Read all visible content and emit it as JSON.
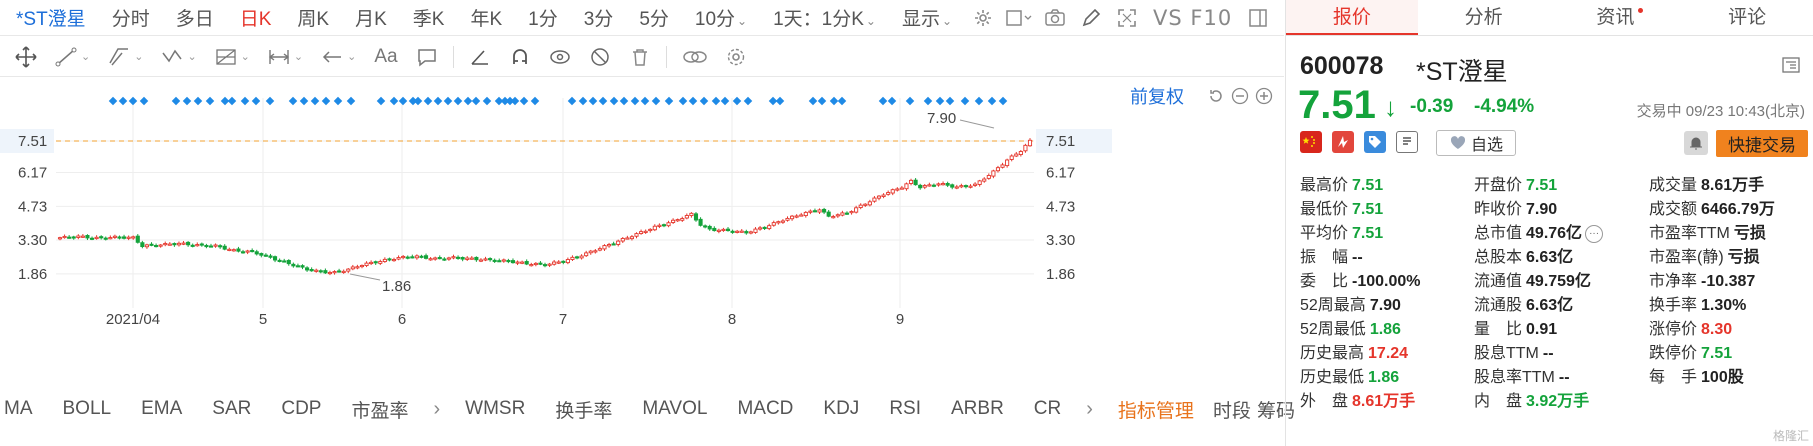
{
  "period_bar": {
    "stock_tab": "*ST澄星",
    "items": [
      "分时",
      "多日",
      "日K",
      "周K",
      "月K",
      "季K",
      "年K",
      "1分",
      "3分",
      "5分",
      "10分"
    ],
    "active": "日K",
    "range_select": "1天：1分K",
    "display": "显示",
    "vs": "VS F10"
  },
  "draw_bar": {
    "aa": "Aa"
  },
  "chart": {
    "fuquan": "前复权",
    "y_ticks": [
      "7.51",
      "6.17",
      "4.73",
      "3.30",
      "1.86"
    ],
    "x_ticks": [
      "2021/04",
      "5",
      "6",
      "7",
      "8",
      "9"
    ],
    "high_label": "7.90",
    "low_label": "1.86",
    "colors": {
      "up": "#e5352b",
      "down": "#14a33b",
      "dash": "#f0a030",
      "event": "#1e8ae6"
    }
  },
  "chart_data": {
    "type": "candlestick",
    "y_ticks": [
      7.51,
      6.17,
      4.73,
      3.3,
      1.86
    ],
    "x_ticks": [
      "2021/04",
      "5",
      "6",
      "7",
      "8",
      "9"
    ],
    "high": 7.9,
    "low": 1.86,
    "last": 7.51,
    "close_path": [
      [
        0,
        3.4
      ],
      [
        4,
        3.45
      ],
      [
        8,
        3.38
      ],
      [
        12,
        3.42
      ],
      [
        16,
        3.4
      ],
      [
        18,
        3.05
      ],
      [
        22,
        3.1
      ],
      [
        26,
        3.15
      ],
      [
        30,
        3.08
      ],
      [
        34,
        3.05
      ],
      [
        38,
        2.85
      ],
      [
        42,
        2.8
      ],
      [
        46,
        2.55
      ],
      [
        50,
        2.3
      ],
      [
        54,
        2.05
      ],
      [
        57,
        1.95
      ],
      [
        60,
        1.92
      ],
      [
        63,
        2.05
      ],
      [
        66,
        2.25
      ],
      [
        70,
        2.4
      ],
      [
        74,
        2.55
      ],
      [
        78,
        2.6
      ],
      [
        82,
        2.5
      ],
      [
        86,
        2.55
      ],
      [
        90,
        2.5
      ],
      [
        94,
        2.45
      ],
      [
        98,
        2.4
      ],
      [
        102,
        2.3
      ],
      [
        106,
        2.25
      ],
      [
        110,
        2.4
      ],
      [
        114,
        2.65
      ],
      [
        118,
        2.95
      ],
      [
        122,
        3.25
      ],
      [
        126,
        3.55
      ],
      [
        130,
        3.85
      ],
      [
        134,
        4.1
      ],
      [
        138,
        4.4
      ],
      [
        140,
        3.95
      ],
      [
        142,
        3.75
      ],
      [
        146,
        3.7
      ],
      [
        150,
        3.62
      ],
      [
        154,
        3.85
      ],
      [
        158,
        4.15
      ],
      [
        162,
        4.4
      ],
      [
        166,
        4.6
      ],
      [
        168,
        4.3
      ],
      [
        172,
        4.45
      ],
      [
        176,
        4.85
      ],
      [
        180,
        5.25
      ],
      [
        184,
        5.55
      ],
      [
        186,
        5.8
      ],
      [
        188,
        5.55
      ],
      [
        192,
        5.7
      ],
      [
        196,
        5.55
      ],
      [
        200,
        5.65
      ],
      [
        204,
        6.2
      ],
      [
        207,
        6.7
      ],
      [
        210,
        7.1
      ],
      [
        212,
        7.51
      ]
    ]
  },
  "indicators": {
    "items": [
      "MA",
      "BOLL",
      "EMA",
      "SAR",
      "CDP",
      "市盈率",
      "WMSR",
      "换手率",
      "MAVOL",
      "MACD",
      "KDJ",
      "RSI",
      "ARBR",
      "CR"
    ],
    "manage": "指标管理",
    "right": [
      "时段",
      "筹码"
    ]
  },
  "quote": {
    "tabs": [
      "报价",
      "分析",
      "资讯",
      "评论"
    ],
    "code": "600078",
    "name": "*ST澄星",
    "price": "7.51",
    "change": "-0.39",
    "pct": "-4.94%",
    "status": "交易中 09/23 10:43(北京)",
    "watch": "自选",
    "quick": "快捷交易",
    "rows": [
      [
        [
          "最高价",
          "7.51",
          "green"
        ],
        [
          "开盘价",
          "7.51",
          "green"
        ],
        [
          "成交量",
          "8.61万手",
          "dark"
        ]
      ],
      [
        [
          "最低价",
          "7.51",
          "green"
        ],
        [
          "昨收价",
          "7.90",
          "dark"
        ],
        [
          "成交额",
          "6466.79万",
          "dark"
        ]
      ],
      [
        [
          "平均价",
          "7.51",
          "green"
        ],
        [
          "总市值",
          "49.76亿",
          "dark"
        ],
        [
          "市盈率TTM",
          "亏损",
          "dark"
        ]
      ],
      [
        [
          "振　幅",
          "--",
          "dark"
        ],
        [
          "总股本",
          "6.63亿",
          "dark"
        ],
        [
          "市盈率(静)",
          "亏损",
          "dark"
        ]
      ],
      [
        [
          "委　比",
          "-100.00%",
          "dark"
        ],
        [
          "流通值",
          "49.759亿",
          "dark"
        ],
        [
          "市净率",
          "-10.387",
          "dark"
        ]
      ],
      [
        [
          "52周最高",
          "7.90",
          "dark"
        ],
        [
          "流通股",
          "6.63亿",
          "dark"
        ],
        [
          "换手率",
          "1.30%",
          "dark"
        ]
      ],
      [
        [
          "52周最低",
          "1.86",
          "green"
        ],
        [
          "量　比",
          "0.91",
          "dark"
        ],
        [
          "涨停价",
          "8.30",
          "red"
        ]
      ],
      [
        [
          "历史最高",
          "17.24",
          "red"
        ],
        [
          "股息TTM",
          "--",
          "dark"
        ],
        [
          "跌停价",
          "7.51",
          "green"
        ]
      ],
      [
        [
          "历史最低",
          "1.86",
          "green"
        ],
        [
          "股息率TTM",
          "--",
          "dark"
        ],
        [
          "每　手",
          "100股",
          "dark"
        ]
      ],
      [
        [
          "外　盘",
          "8.61万手",
          "red"
        ],
        [
          "内　盘",
          "3.92万手",
          "green"
        ],
        [
          "",
          "",
          "dark"
        ]
      ]
    ],
    "watermark": "格隆汇"
  }
}
